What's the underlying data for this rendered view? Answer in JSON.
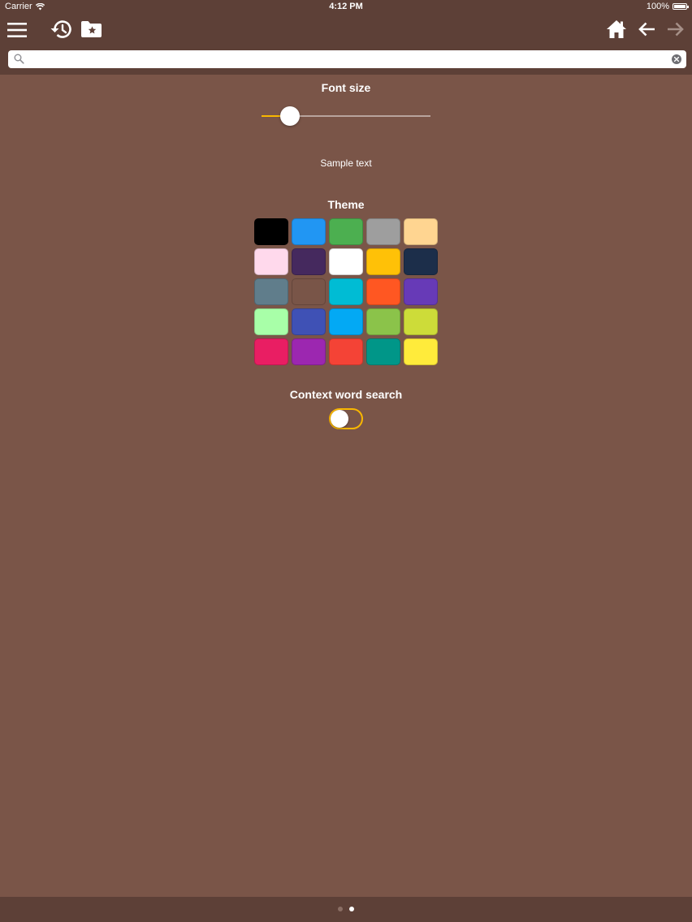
{
  "status_bar": {
    "carrier": "Carrier",
    "time": "4:12 PM",
    "battery": "100%"
  },
  "toolbar": {
    "icons": [
      "menu-icon",
      "history-icon",
      "favorites-folder-icon",
      "home-icon",
      "back-arrow-icon",
      "forward-arrow-icon"
    ]
  },
  "search": {
    "placeholder": "",
    "value": ""
  },
  "font_size": {
    "title": "Font size",
    "level": 0.17,
    "sample": "Sample text"
  },
  "theme": {
    "title": "Theme",
    "colors": [
      "#000000",
      "#2196f3",
      "#4caf50",
      "#9e9e9e",
      "#ffd591",
      "#ffd9ec",
      "#45295e",
      "#ffffff",
      "#ffc107",
      "#1c2e4a",
      "#607d8b",
      "#795548",
      "#00bcd4",
      "#ff5722",
      "#673ab7",
      "#a8ffa8",
      "#3f51b5",
      "#03a9f4",
      "#8bc34a",
      "#cddc39",
      "#e91e63",
      "#9c27b0",
      "#f44336",
      "#009688",
      "#ffeb3b"
    ]
  },
  "context_search": {
    "title": "Context word search",
    "enabled": false
  },
  "colors": {
    "background": "#7a5548",
    "bars": "#5d4037",
    "accent": "#f9b700"
  },
  "pager": {
    "count": 2,
    "active": 1
  }
}
